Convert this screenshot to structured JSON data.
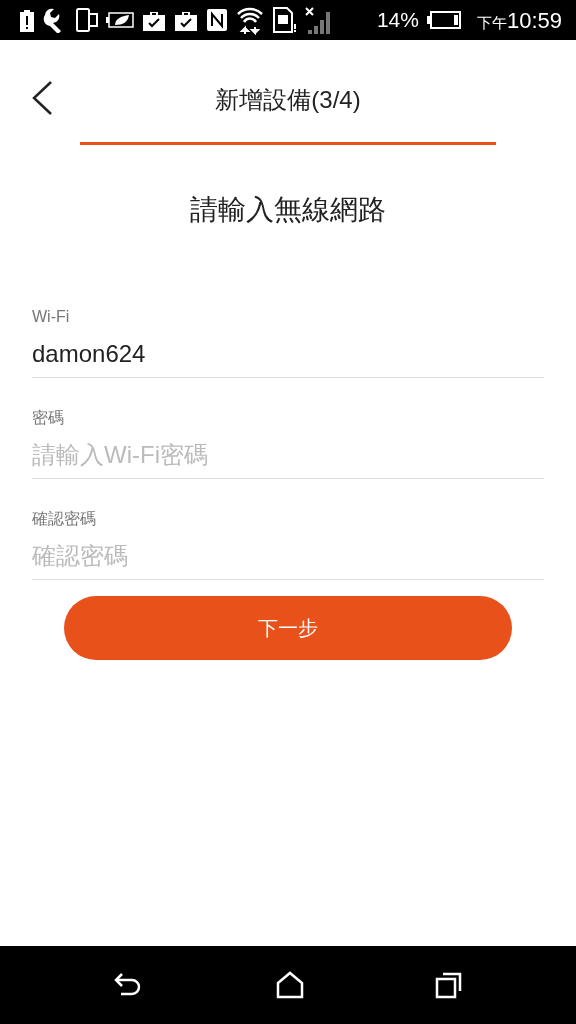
{
  "status_bar": {
    "battery_percent": "14%",
    "time_period": "下午",
    "time": "10:59"
  },
  "header": {
    "title": "新增設備(3/4)"
  },
  "subtitle": "請輸入無線網路",
  "fields": [
    {
      "label": "Wi-Fi",
      "value": "damon624"
    },
    {
      "label": "密碼",
      "placeholder": "請輸入Wi-Fi密碼"
    },
    {
      "label": "確認密碼",
      "placeholder": "確認密碼"
    }
  ],
  "next_button": "下一步"
}
